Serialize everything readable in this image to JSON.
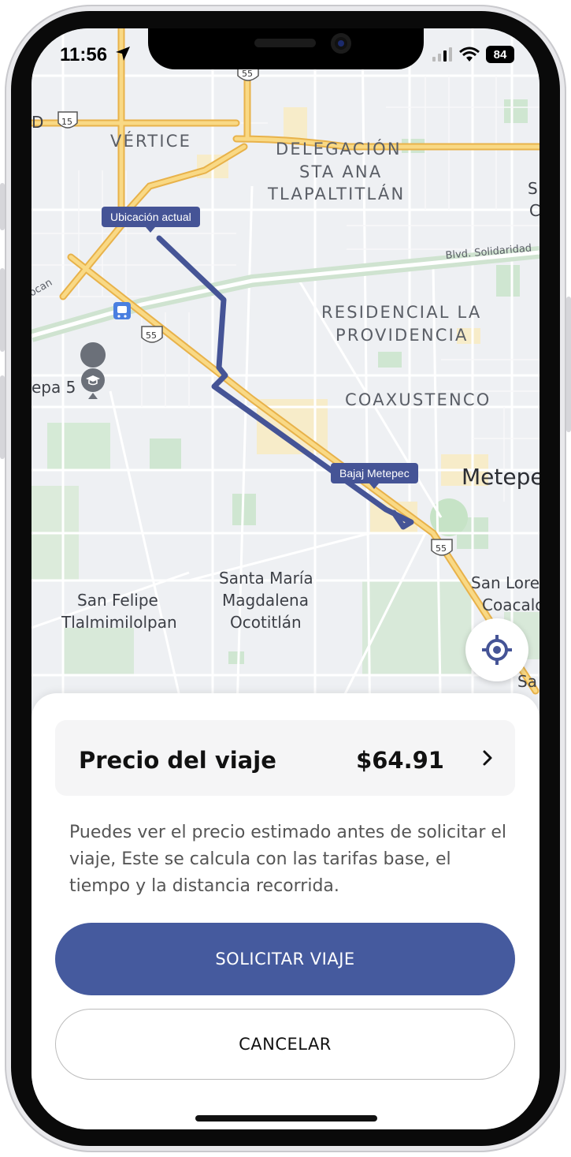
{
  "status_bar": {
    "time": "11:56",
    "battery": "84"
  },
  "map": {
    "labels": {
      "vertice": "VÉRTICE",
      "delegacion_1": "DELEGACIÓN",
      "delegacion_2": "STA ANA",
      "delegacion_3": "TLAPALTITLÁN",
      "residencial_1": "RESIDENCIAL LA",
      "residencial_2": "PROVIDENCIA",
      "coaxustenco": "COAXUSTENCO",
      "metepec": "Metepe",
      "blvd": "Blvd. Solidaridad",
      "santa_maria_1": "Santa María",
      "santa_maria_2": "Magdalena",
      "santa_maria_3": "Ocotitlán",
      "san_felipe_1": "San Felipe",
      "san_felipe_2": "Tlalmimilolpan",
      "san_lore_1": "San Lore",
      "san_lore_2": "Coacalc",
      "epa5": "epa 5",
      "ocan": "ocan",
      "edge_s": "S",
      "edge_c": "C",
      "edge_sa": "Sa",
      "edge_d": "D",
      "hwy_15": "15",
      "hwy_55": "55"
    },
    "pin_origin": "Ubicación actual",
    "pin_destination": "Bajaj Metepec"
  },
  "sheet": {
    "price_label": "Precio del viaje",
    "price_value": "$64.91",
    "description": "Puedes ver el precio estimado antes de solicitar el viaje, Este se calcula con las tarifas base, el tiempo y la distancia recorrida.",
    "request_button": "SOLICITAR VIAJE",
    "cancel_button": "CANCELAR"
  },
  "colors": {
    "route": "#455496",
    "primary_button": "#455a9e",
    "highway": "#f3c95a"
  },
  "icons": [
    "location-arrow-icon",
    "signal-icon",
    "wifi-icon",
    "battery-icon",
    "crosshair-icon",
    "chevron-right-icon",
    "school-icon",
    "train-icon"
  ]
}
